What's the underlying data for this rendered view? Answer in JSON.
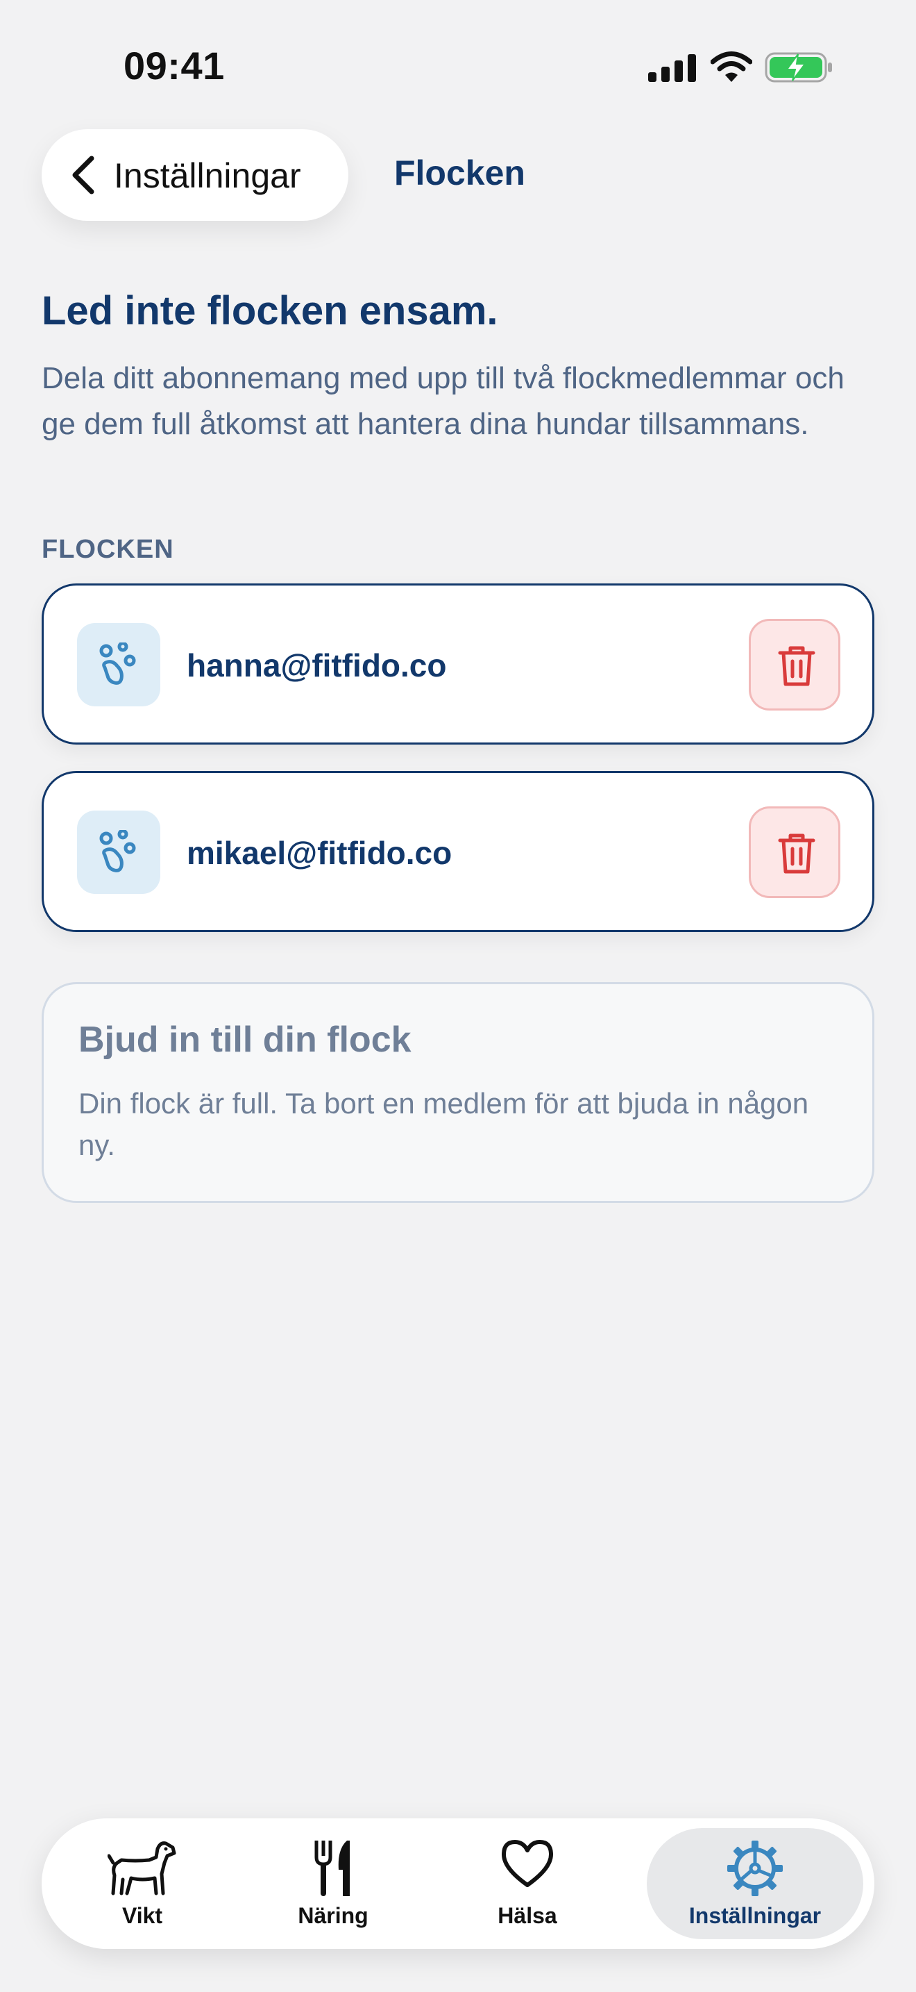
{
  "status_bar": {
    "time": "09:41",
    "icons": [
      "cellular-signal-icon",
      "wifi-icon",
      "battery-charging-icon"
    ]
  },
  "header": {
    "back_label": "Inställningar",
    "title": "Flocken"
  },
  "intro": {
    "headline": "Led inte flocken ensam.",
    "description": "Dela ditt abonnemang med upp till två flockmedlemmar och ge dem full åtkomst att hantera dina hundar tillsammans."
  },
  "members": {
    "section_label": "FLOCKEN",
    "items": [
      {
        "email": "hanna@fitfido.co",
        "icon": "paw-icon"
      },
      {
        "email": "mikael@fitfido.co",
        "icon": "paw-icon"
      }
    ]
  },
  "invite": {
    "title": "Bjud in till din flock",
    "text": "Din flock är full. Ta bort en medlem för att bjuda in någon ny."
  },
  "tab_bar": {
    "tabs": [
      {
        "label": "Vikt",
        "icon": "dog-icon"
      },
      {
        "label": "Näring",
        "icon": "fork-knife-icon"
      },
      {
        "label": "Hälsa",
        "icon": "heart-icon"
      },
      {
        "label": "Inställningar",
        "icon": "gear-icon",
        "selected": true
      }
    ]
  },
  "colors": {
    "primary": "#12386b",
    "muted_text": "#4f6585",
    "accent_blue": "#3a87c0",
    "delete_red": "#d93b3b",
    "delete_bg": "#fde7e7",
    "battery_green": "#34c759",
    "background": "#f2f2f3"
  }
}
